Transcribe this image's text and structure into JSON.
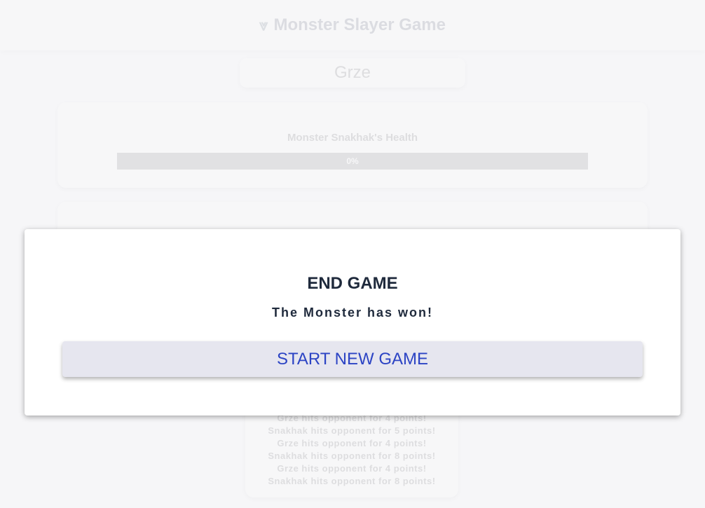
{
  "header": {
    "logo_glyph": "⩔",
    "title": "Monster Slayer Game"
  },
  "player": {
    "name": "Grze"
  },
  "monster": {
    "health_label": "Monster Snakhak's Health",
    "health_percent_text": "0%",
    "health_fraction": 0
  },
  "battle_log": {
    "entries": [
      "Grze hits opponent for 4 points!",
      "Snakhak hits opponent for 5 points!",
      "Grze hits opponent for 4 points!",
      "Snakhak hits opponent for 8 points!",
      "Grze hits opponent for 4 points!",
      "Snakhak hits opponent for 8 points!"
    ]
  },
  "modal": {
    "title": "END GAME",
    "message": "The Monster has won!",
    "button_label": "START NEW GAME"
  },
  "colors": {
    "accent": "#2c44c4",
    "text_dark": "#1f2a3c",
    "button_bg": "#e6e6ef"
  }
}
